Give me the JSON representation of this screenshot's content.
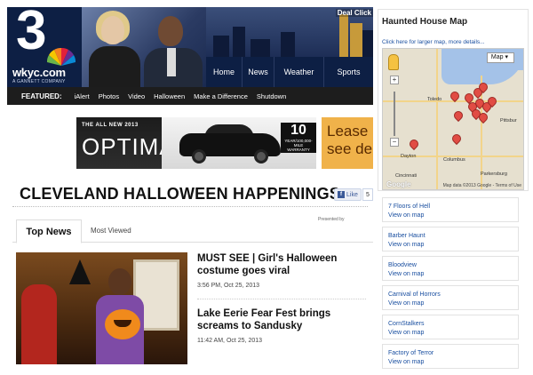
{
  "header": {
    "logo_number": "3",
    "logo_text": "wkyc.com",
    "logo_sub": "A GANNETT COMPANY",
    "deal_click": "Deal Click",
    "nav": [
      "Home",
      "News",
      "Weather",
      "Sports"
    ]
  },
  "featured": {
    "label": "FEATURED:",
    "items": [
      "iAlert",
      "Photos",
      "Video",
      "Halloween",
      "Make a Difference",
      "Shutdown"
    ]
  },
  "ad": {
    "small": "THE ALL NEW 2013",
    "big": "OPTIMA",
    "warranty_num": "10",
    "warranty_line1": "YEAR/100,000-MILE",
    "warranty_line2": "WARRANTY",
    "right_text_1": "Lease",
    "right_text_2": "see de"
  },
  "page": {
    "title": "CLEVELAND HALLOWEEN HAPPENINGS",
    "like_label": "Like",
    "like_count": "5",
    "presented_by": "Presented by"
  },
  "tabs": {
    "active": "Top News",
    "inactive": "Most Viewed"
  },
  "news": [
    {
      "headline": "MUST SEE | Girl's Halloween costume goes viral",
      "timestamp": "3:56 PM, Oct 25, 2013"
    },
    {
      "headline": "Lake Eerie Fear Fest brings screams to Sandusky",
      "timestamp": "11:42 AM, Oct 25, 2013"
    }
  ],
  "map": {
    "title": "Haunted House Map",
    "link": "Click here for larger map, more details...",
    "type": "Map",
    "credit": "Map data ©2013 Google - Terms of Use",
    "google": "Google",
    "cities": [
      "Toledo",
      "Pittsbur",
      "Dayton",
      "Columbus",
      "Cincinnati",
      "Parkersburg"
    ]
  },
  "houses": [
    {
      "name": "7 Floors of Hell",
      "link": "View on map"
    },
    {
      "name": "Barber Haunt",
      "link": "View on map"
    },
    {
      "name": "Bloodview",
      "link": "View on map"
    },
    {
      "name": "Carnival of Horrors",
      "link": "View on map"
    },
    {
      "name": "CornStalkers",
      "link": "View on map"
    },
    {
      "name": "Factory of Terror",
      "link": "View on map"
    }
  ]
}
